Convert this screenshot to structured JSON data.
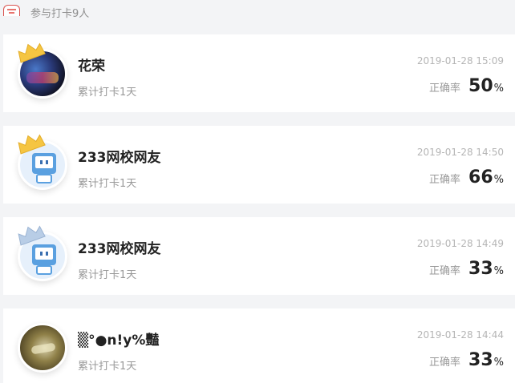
{
  "header": {
    "text": "参与打卡9人",
    "icon": "list-icon"
  },
  "records": [
    {
      "name": "花荣",
      "days": "累计打卡1天",
      "time": "2019-01-28 15:09",
      "accuracy_label": "正确率",
      "accuracy": "50",
      "unit": "%",
      "avatar": "photo-avatar",
      "crown": "gold"
    },
    {
      "name": "233网校网友",
      "days": "累计打卡1天",
      "time": "2019-01-28 14:50",
      "accuracy_label": "正确率",
      "accuracy": "66",
      "unit": "%",
      "avatar": "robot-avatar",
      "crown": "gold"
    },
    {
      "name": "233网校网友",
      "days": "累计打卡1天",
      "time": "2019-01-28 14:49",
      "accuracy_label": "正确率",
      "accuracy": "33",
      "unit": "%",
      "avatar": "robot-avatar",
      "crown": "silver"
    },
    {
      "name": "▒°●n!y%豔",
      "days": "累计打卡1天",
      "time": "2019-01-28 14:44",
      "accuracy_label": "正确率",
      "accuracy": "33",
      "unit": "%",
      "avatar": "photo-avatar",
      "crown": "none"
    }
  ],
  "colors": {
    "gold_crown": "#f5c542",
    "silver_crown": "#b8cde6",
    "accent": "#d9534f"
  }
}
